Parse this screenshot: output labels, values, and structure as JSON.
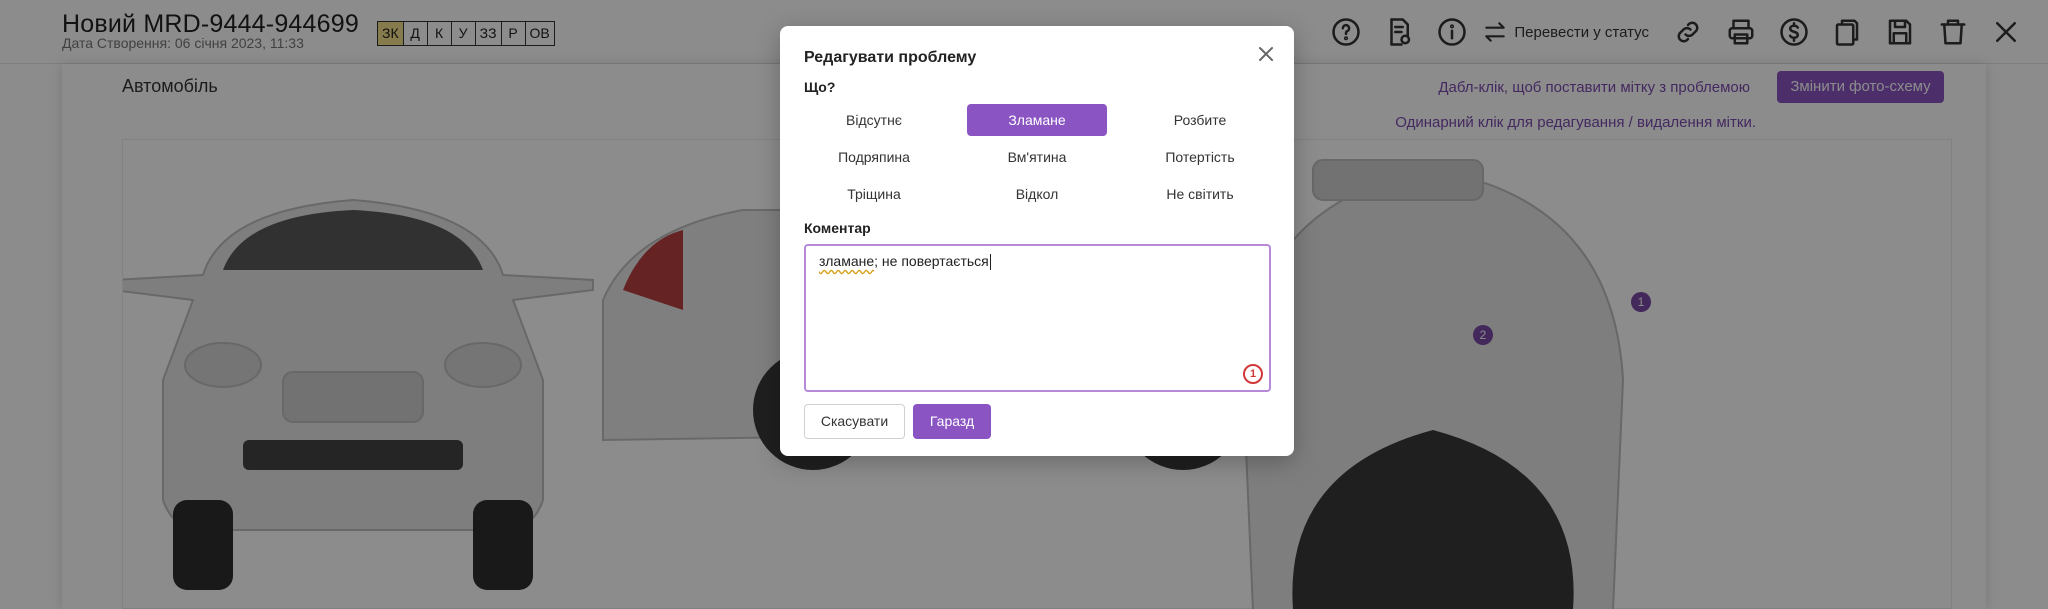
{
  "header": {
    "title": "Новий MRD-9444-944699",
    "created": "Дата Створення: 06 січня 2023, 11:33",
    "stages": [
      {
        "label": "ЗК",
        "active": true
      },
      {
        "label": "Д",
        "active": false
      },
      {
        "label": "К",
        "active": false
      },
      {
        "label": "У",
        "active": false
      },
      {
        "label": "ЗЗ",
        "active": false
      },
      {
        "label": "Р",
        "active": false
      },
      {
        "label": "ОВ",
        "active": false
      }
    ],
    "status_button": "Перевести у статус",
    "icons": [
      "help-icon",
      "document-check-icon",
      "info-icon",
      "status-arrows-icon",
      "link-icon",
      "print-icon",
      "dollar-icon",
      "copy-icon",
      "save-icon",
      "trash-icon",
      "close-icon"
    ]
  },
  "vehicle": {
    "section_label": "Автомобіль",
    "hint_double_click": "Дабл-клік, щоб поставити мітку з проблемою",
    "hint_single_click": "Одинарний клік для редагування / видалення мітки.",
    "change_photo_button": "Змінити фото-схему",
    "markers": [
      "1",
      "2"
    ]
  },
  "modal": {
    "title": "Редагувати проблему",
    "what_label": "Що?",
    "options": [
      {
        "label": "Відсутнє",
        "selected": false
      },
      {
        "label": "Зламане",
        "selected": true
      },
      {
        "label": "Розбите",
        "selected": false
      },
      {
        "label": "Подряпина",
        "selected": false
      },
      {
        "label": "Вм'ятина",
        "selected": false
      },
      {
        "label": "Потертість",
        "selected": false
      },
      {
        "label": "Тріщина",
        "selected": false
      },
      {
        "label": "Відкол",
        "selected": false
      },
      {
        "label": "Не світить",
        "selected": false
      }
    ],
    "comment_label": "Коментар",
    "comment_word": "зламане",
    "comment_rest": "; не повертається",
    "grammar_badge": "1",
    "cancel_button": "Скасувати",
    "ok_button": "Гаразд"
  },
  "colors": {
    "accent": "#8a55c2",
    "active_stage": "#f3e08a",
    "hint_text": "#7d4bb0"
  }
}
